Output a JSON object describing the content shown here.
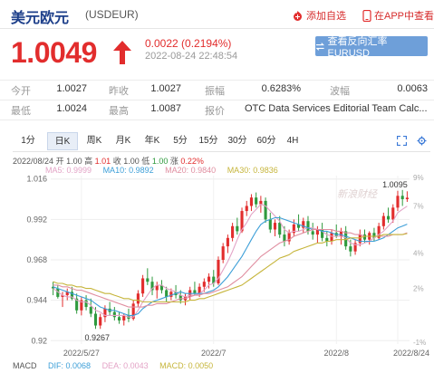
{
  "header": {
    "title": "美元欧元",
    "code": "(USDEUR)",
    "add_fav": "添加自选",
    "app_view": "在APP中查看"
  },
  "quote": {
    "price": "1.0049",
    "change": "0.0022 (0.2194%)",
    "timestamp": "2022-08-24 22:48:54",
    "reverse_btn": "查看反向汇率 EURUSD"
  },
  "stats": [
    [
      {
        "label": "今开",
        "value": "1.0027"
      },
      {
        "label": "昨收",
        "value": "1.0027"
      },
      {
        "label": "振幅",
        "value": "0.6283%"
      },
      {
        "label": "波幅",
        "value": "0.0063"
      }
    ],
    [
      {
        "label": "最低",
        "value": "1.0024"
      },
      {
        "label": "最高",
        "value": "1.0087"
      },
      {
        "label": "报价",
        "value": "OTC Data Services Editorial Team Calc..."
      }
    ]
  ],
  "tabs": [
    "1分",
    "日K",
    "周K",
    "月K",
    "年K",
    "5分",
    "15分",
    "30分",
    "60分",
    "4H"
  ],
  "active_tab": "日K",
  "info": {
    "date": "2022/08/24",
    "open_label": "开",
    "open": "1.00",
    "high_label": "高",
    "high": "1.01",
    "low_label": "收",
    "low": "1.00",
    "close_label": "低",
    "close": "1.00",
    "chg_label": "涨",
    "chg": "0.22%"
  },
  "ma": [
    {
      "label": "MA5: 0.9999",
      "color": "#e3a3c6"
    },
    {
      "label": "MA10: 0.9892",
      "color": "#3d9fd8"
    },
    {
      "label": "MA20: 0.9840",
      "color": "#e08ea0"
    },
    {
      "label": "MA30: 0.9836",
      "color": "#c6b53b"
    }
  ],
  "watermark": "新浪财经",
  "chart_data": {
    "type": "candlestick",
    "yticks": [
      "1.016",
      "0.992",
      "0.968",
      "0.944",
      "0.92"
    ],
    "pct_ticks": [
      "9%",
      "7%",
      "4%",
      "2%",
      "-1%"
    ],
    "xticks": [
      "2022/5/27",
      "2022/7",
      "2022/8",
      "2022/8/24"
    ],
    "ylim": [
      0.918,
      1.018
    ],
    "annotations": [
      {
        "text": "0.9267",
        "value": 0.9267
      },
      {
        "text": "1.0095",
        "value": 1.0095
      }
    ],
    "candles": [
      [
        0.952,
        0.955,
        0.947,
        0.951
      ],
      [
        0.951,
        0.953,
        0.945,
        0.946
      ],
      [
        0.946,
        0.949,
        0.94,
        0.947
      ],
      [
        0.947,
        0.951,
        0.944,
        0.949
      ],
      [
        0.949,
        0.952,
        0.944,
        0.945
      ],
      [
        0.945,
        0.948,
        0.936,
        0.938
      ],
      [
        0.938,
        0.946,
        0.935,
        0.944
      ],
      [
        0.944,
        0.947,
        0.938,
        0.94
      ],
      [
        0.94,
        0.945,
        0.934,
        0.936
      ],
      [
        0.936,
        0.94,
        0.927,
        0.929
      ],
      [
        0.929,
        0.936,
        0.927,
        0.934
      ],
      [
        0.934,
        0.941,
        0.931,
        0.939
      ],
      [
        0.939,
        0.943,
        0.935,
        0.937
      ],
      [
        0.937,
        0.94,
        0.932,
        0.934
      ],
      [
        0.934,
        0.937,
        0.93,
        0.932
      ],
      [
        0.932,
        0.936,
        0.929,
        0.935
      ],
      [
        0.935,
        0.939,
        0.931,
        0.933
      ],
      [
        0.933,
        0.944,
        0.932,
        0.942
      ],
      [
        0.942,
        0.95,
        0.94,
        0.948
      ],
      [
        0.948,
        0.959,
        0.946,
        0.957
      ],
      [
        0.957,
        0.963,
        0.953,
        0.955
      ],
      [
        0.955,
        0.958,
        0.947,
        0.95
      ],
      [
        0.95,
        0.955,
        0.945,
        0.953
      ],
      [
        0.953,
        0.956,
        0.948,
        0.95
      ],
      [
        0.95,
        0.952,
        0.943,
        0.946
      ],
      [
        0.946,
        0.951,
        0.944,
        0.949
      ],
      [
        0.949,
        0.953,
        0.945,
        0.947
      ],
      [
        0.947,
        0.95,
        0.942,
        0.944
      ],
      [
        0.944,
        0.948,
        0.941,
        0.946
      ],
      [
        0.946,
        0.952,
        0.944,
        0.95
      ],
      [
        0.95,
        0.955,
        0.947,
        0.948
      ],
      [
        0.948,
        0.954,
        0.946,
        0.952
      ],
      [
        0.952,
        0.957,
        0.949,
        0.955
      ],
      [
        0.955,
        0.96,
        0.951,
        0.958
      ],
      [
        0.958,
        0.962,
        0.952,
        0.954
      ],
      [
        0.954,
        0.97,
        0.953,
        0.968
      ],
      [
        0.968,
        0.978,
        0.966,
        0.976
      ],
      [
        0.976,
        0.983,
        0.972,
        0.981
      ],
      [
        0.981,
        0.99,
        0.979,
        0.988
      ],
      [
        0.988,
        0.993,
        0.983,
        0.985
      ],
      [
        0.985,
        0.999,
        0.984,
        0.997
      ],
      [
        0.997,
        1.003,
        0.994,
        1.0
      ],
      [
        1.0,
        1.007,
        0.997,
        1.005
      ],
      [
        1.005,
        1.008,
        0.999,
        1.001
      ],
      [
        1.001,
        1.006,
        0.996,
        1.003
      ],
      [
        1.003,
        1.005,
        0.99,
        0.992
      ],
      [
        0.992,
        0.996,
        0.984,
        0.986
      ],
      [
        0.986,
        0.992,
        0.982,
        0.99
      ],
      [
        0.99,
        0.994,
        0.981,
        0.983
      ],
      [
        0.983,
        0.988,
        0.976,
        0.979
      ],
      [
        0.979,
        0.986,
        0.977,
        0.984
      ],
      [
        0.984,
        0.992,
        0.982,
        0.989
      ],
      [
        0.989,
        0.995,
        0.985,
        0.987
      ],
      [
        0.987,
        0.993,
        0.984,
        0.991
      ],
      [
        0.991,
        0.994,
        0.983,
        0.985
      ],
      [
        0.985,
        0.99,
        0.98,
        0.983
      ],
      [
        0.983,
        0.988,
        0.978,
        0.986
      ],
      [
        0.986,
        0.99,
        0.979,
        0.981
      ],
      [
        0.981,
        0.985,
        0.976,
        0.979
      ],
      [
        0.979,
        0.986,
        0.977,
        0.984
      ],
      [
        0.984,
        0.989,
        0.981,
        0.982
      ],
      [
        0.982,
        0.987,
        0.977,
        0.985
      ],
      [
        0.985,
        0.988,
        0.974,
        0.976
      ],
      [
        0.976,
        0.98,
        0.97,
        0.973
      ],
      [
        0.973,
        0.98,
        0.971,
        0.978
      ],
      [
        0.978,
        0.986,
        0.976,
        0.983
      ],
      [
        0.983,
        0.986,
        0.978,
        0.98
      ],
      [
        0.98,
        0.985,
        0.977,
        0.984
      ],
      [
        0.984,
        0.987,
        0.979,
        0.981
      ],
      [
        0.981,
        0.99,
        0.98,
        0.988
      ],
      [
        0.988,
        0.996,
        0.986,
        0.994
      ],
      [
        0.994,
        0.999,
        0.99,
        0.992
      ],
      [
        0.992,
        1.001,
        0.99,
        0.999
      ],
      [
        0.999,
        1.009,
        0.997,
        1.006
      ],
      [
        1.006,
        1.0095,
        1.0,
        1.004
      ],
      [
        1.004,
        1.0087,
        1.0024,
        1.0049
      ]
    ],
    "ma_series": [
      {
        "label": "MA5",
        "color": "#e3a3c6",
        "values": [
          0.951,
          0.949,
          0.947,
          0.946,
          0.946,
          0.944,
          0.943,
          0.943,
          0.941,
          0.938,
          0.937,
          0.935,
          0.935,
          0.935,
          0.935,
          0.935,
          0.934,
          0.934,
          0.938,
          0.943,
          0.947,
          0.951,
          0.953,
          0.953,
          0.951,
          0.95,
          0.949,
          0.947,
          0.946,
          0.947,
          0.947,
          0.948,
          0.95,
          0.953,
          0.954,
          0.957,
          0.962,
          0.967,
          0.973,
          0.98,
          0.986,
          0.99,
          0.995,
          0.998,
          1.001,
          1.0,
          0.997,
          0.994,
          0.991,
          0.986,
          0.984,
          0.985,
          0.985,
          0.986,
          0.987,
          0.987,
          0.986,
          0.985,
          0.983,
          0.982,
          0.982,
          0.982,
          0.981,
          0.978,
          0.977,
          0.977,
          0.978,
          0.979,
          0.981,
          0.983,
          0.985,
          0.988,
          0.991,
          0.996,
          0.998,
          0.9999
        ]
      },
      {
        "label": "MA10",
        "color": "#3d9fd8",
        "values": [
          0.952,
          0.951,
          0.95,
          0.949,
          0.948,
          0.947,
          0.946,
          0.945,
          0.944,
          0.942,
          0.94,
          0.939,
          0.938,
          0.938,
          0.937,
          0.936,
          0.935,
          0.935,
          0.936,
          0.939,
          0.941,
          0.943,
          0.944,
          0.945,
          0.946,
          0.947,
          0.948,
          0.949,
          0.948,
          0.948,
          0.948,
          0.948,
          0.948,
          0.949,
          0.95,
          0.952,
          0.955,
          0.958,
          0.962,
          0.966,
          0.97,
          0.975,
          0.98,
          0.985,
          0.989,
          0.991,
          0.992,
          0.993,
          0.993,
          0.992,
          0.991,
          0.99,
          0.989,
          0.988,
          0.987,
          0.986,
          0.986,
          0.985,
          0.985,
          0.984,
          0.983,
          0.983,
          0.982,
          0.981,
          0.98,
          0.979,
          0.979,
          0.979,
          0.979,
          0.98,
          0.981,
          0.983,
          0.985,
          0.987,
          0.988,
          0.9892
        ]
      },
      {
        "label": "MA20",
        "color": "#e08ea0",
        "values": [
          0.953,
          0.953,
          0.952,
          0.952,
          0.951,
          0.95,
          0.95,
          0.949,
          0.948,
          0.947,
          0.946,
          0.945,
          0.944,
          0.943,
          0.942,
          0.941,
          0.94,
          0.94,
          0.94,
          0.94,
          0.941,
          0.941,
          0.942,
          0.942,
          0.942,
          0.943,
          0.944,
          0.945,
          0.945,
          0.946,
          0.947,
          0.947,
          0.948,
          0.948,
          0.949,
          0.95,
          0.951,
          0.952,
          0.954,
          0.956,
          0.958,
          0.961,
          0.964,
          0.967,
          0.97,
          0.972,
          0.974,
          0.976,
          0.978,
          0.979,
          0.98,
          0.982,
          0.983,
          0.984,
          0.985,
          0.986,
          0.986,
          0.986,
          0.986,
          0.986,
          0.985,
          0.985,
          0.984,
          0.984,
          0.983,
          0.983,
          0.982,
          0.982,
          0.982,
          0.982,
          0.982,
          0.982,
          0.983,
          0.983,
          0.983,
          0.984
        ]
      },
      {
        "label": "MA30",
        "color": "#c6b53b",
        "values": [
          0.955,
          0.954,
          0.954,
          0.953,
          0.953,
          0.952,
          0.952,
          0.951,
          0.951,
          0.95,
          0.949,
          0.948,
          0.948,
          0.947,
          0.946,
          0.945,
          0.945,
          0.944,
          0.944,
          0.943,
          0.943,
          0.943,
          0.943,
          0.943,
          0.943,
          0.943,
          0.943,
          0.943,
          0.943,
          0.944,
          0.944,
          0.945,
          0.945,
          0.946,
          0.947,
          0.948,
          0.949,
          0.95,
          0.951,
          0.952,
          0.953,
          0.955,
          0.957,
          0.959,
          0.961,
          0.963,
          0.965,
          0.967,
          0.969,
          0.97,
          0.971,
          0.973,
          0.974,
          0.975,
          0.976,
          0.977,
          0.978,
          0.978,
          0.979,
          0.979,
          0.98,
          0.98,
          0.98,
          0.981,
          0.981,
          0.981,
          0.982,
          0.982,
          0.982,
          0.982,
          0.983,
          0.983,
          0.983,
          0.983,
          0.983,
          0.9836
        ]
      }
    ]
  },
  "macd": {
    "label": "MACD",
    "dif": "DIF: 0.0068",
    "dea": "DEA: 0.0043",
    "macd": "MACD: 0.0050",
    "dif_color": "#3d9fd8",
    "dea_color": "#e3a3c6",
    "macd_color": "#c6b53b"
  },
  "colors": {
    "up": "#e22d2d",
    "down": "#2f9a3e",
    "brand": "#1d3f8a",
    "button": "#6e9fd9"
  }
}
